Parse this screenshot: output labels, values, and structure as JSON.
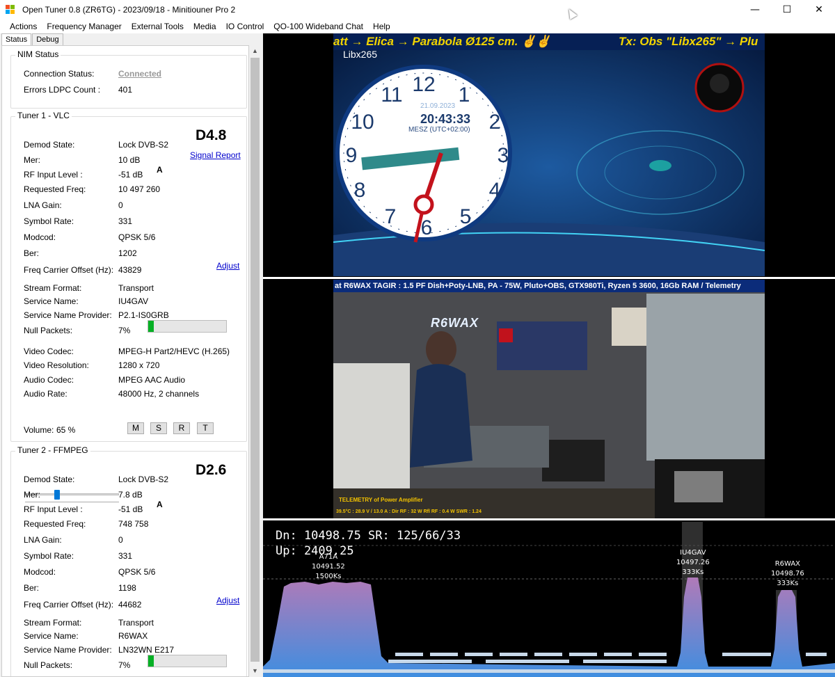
{
  "window": {
    "title": "Open Tuner 0.8 (ZR6TG) - 2023/09/18 - Minitiouner Pro 2",
    "minimize": "—",
    "maximize": "☐",
    "close": "✕"
  },
  "menu": [
    "Actions",
    "Frequency Manager",
    "External Tools",
    "Media",
    "IO Control",
    "QO-100 Wideband Chat",
    "Help"
  ],
  "tabs": [
    "Status",
    "Debug"
  ],
  "nim": {
    "title": "NIM Status",
    "connection_label": "Connection Status:",
    "connection_value": "Connected",
    "errors_label": "Errors LDPC Count :",
    "errors_value": "401"
  },
  "tuner1": {
    "title": "Tuner 1 - VLC",
    "badge": "D4.8",
    "signal_report": "Signal Report",
    "adjust": "Adjust",
    "rf_flag": "A",
    "rows": [
      {
        "label": "Demod State:",
        "value": "Lock DVB-S2"
      },
      {
        "label": "Mer:",
        "value": "10 dB"
      },
      {
        "label": "RF Input Level :",
        "value": "-51 dB"
      },
      {
        "label": "Requested Freq:",
        "value": "10 497 260"
      },
      {
        "label": "LNA Gain:",
        "value": "0"
      },
      {
        "label": "Symbol Rate:",
        "value": "331"
      },
      {
        "label": "Modcod:",
        "value": "QPSK 5/6"
      },
      {
        "label": "Ber:",
        "value": "1202"
      },
      {
        "label": "Freq Carrier Offset (Hz):",
        "value": "43829"
      },
      {
        "label": "Stream Format:",
        "value": "Transport"
      },
      {
        "label": "Service Name:",
        "value": "IU4GAV"
      },
      {
        "label": "Service Name Provider:",
        "value": "P2.1-IS0GRB"
      },
      {
        "label": "Null Packets:",
        "value": "7%"
      },
      {
        "label": "Video Codec:",
        "value": "MPEG-H Part2/HEVC (H.265)"
      },
      {
        "label": "Video Resolution:",
        "value": "1280 x 720"
      },
      {
        "label": "Audio Codec:",
        "value": "MPEG AAC Audio"
      },
      {
        "label": "Audio Rate:",
        "value": "48000 Hz, 2 channels"
      }
    ],
    "null_packets_fraction": 0.07,
    "volume_label": "Volume:",
    "volume_value": "65 %",
    "volume_fraction": 0.65,
    "buttons": [
      "M",
      "S",
      "R",
      "T"
    ]
  },
  "tuner2": {
    "title": "Tuner 2 - FFMPEG",
    "badge": "D2.6",
    "adjust": "Adjust",
    "rf_flag": "A",
    "rows": [
      {
        "label": "Demod State:",
        "value": "Lock DVB-S2"
      },
      {
        "label": "Mer:",
        "value": "7.8 dB"
      },
      {
        "label": "RF Input Level :",
        "value": "-51 dB"
      },
      {
        "label": "Requested Freq:",
        "value": "748 758"
      },
      {
        "label": "LNA Gain:",
        "value": "0"
      },
      {
        "label": "Symbol Rate:",
        "value": "331"
      },
      {
        "label": "Modcod:",
        "value": "QPSK 5/6"
      },
      {
        "label": "Ber:",
        "value": "1198"
      },
      {
        "label": "Freq Carrier Offset (Hz):",
        "value": "44682"
      },
      {
        "label": "Stream Format:",
        "value": "Transport"
      },
      {
        "label": "Service Name:",
        "value": "R6WAX"
      },
      {
        "label": "Service Name Provider:",
        "value": "LN32WN E217"
      },
      {
        "label": "Null Packets:",
        "value": "7%"
      }
    ],
    "null_packets_fraction": 0.07
  },
  "video1": {
    "ticker_left": "att → Elica → Parabola Ø125 cm. ✌✌",
    "ticker_right": "Tx: Obs \"Libx265\" → Plu",
    "channel": "Libx265",
    "clock_date": "21.09.2023",
    "clock_time": "20:43:33",
    "clock_tz": "MESZ (UTC+02:00)"
  },
  "video2": {
    "ticker": "at R6WAX TAGIR : 1.5 PF Dish+Poty-LNB, PA - 75W, Pluto+OBS, GTX980Ti, Ryzen 5 3600, 16Gb RAM / Telemetry",
    "brand": "R6WAX",
    "caption": "TELEMETRY of Power Amplifier",
    "caption2": "39.5°C : 28.9 V / 13.0 A : Dir RF : 32 W Rfl RF : 0.4 W SWR : 1.24"
  },
  "spectrum": {
    "dn": "Dn: 10498.75  SR: 125/66/33",
    "up": "Up: 2409.25",
    "signals": [
      {
        "name": "A71A",
        "freq": "10491.52",
        "sr": "1500Ks"
      },
      {
        "name": "IU4GAV",
        "freq": "10497.26",
        "sr": "333Ks"
      },
      {
        "name": "R6WAX",
        "freq": "10498.76",
        "sr": "333Ks"
      }
    ]
  }
}
